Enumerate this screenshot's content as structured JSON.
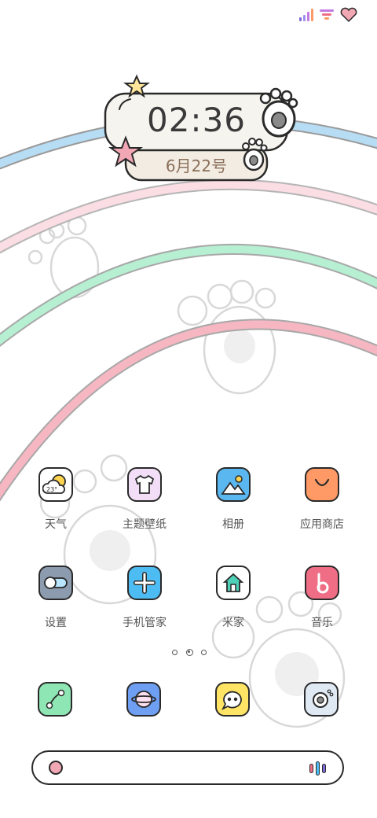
{
  "status_bar": {
    "icons": [
      "signal-icon",
      "wifi-icon",
      "battery-heart-icon"
    ],
    "colors": {
      "signal": "#7b6cd8",
      "wifi": "#c27be0",
      "heart": "#f2a7b4"
    }
  },
  "clock": {
    "time": "02:36",
    "date": "6月22号"
  },
  "apps_row1": [
    {
      "label": "天气",
      "icon": "weather-icon",
      "temp": "23°",
      "color": "#ffffff"
    },
    {
      "label": "主题壁纸",
      "icon": "theme-shirt-icon",
      "color": "#f2dff7"
    },
    {
      "label": "相册",
      "icon": "gallery-icon",
      "color": "#5ab7ef"
    },
    {
      "label": "应用商店",
      "icon": "app-store-bag-icon",
      "color": "#ff9966"
    }
  ],
  "apps_row2": [
    {
      "label": "设置",
      "icon": "settings-toggle-icon",
      "color": "#8c9cae"
    },
    {
      "label": "手机管家",
      "icon": "security-plus-icon",
      "color": "#4dbcf2"
    },
    {
      "label": "米家",
      "icon": "home-icon",
      "color": "#ffffff"
    },
    {
      "label": "音乐",
      "icon": "music-note-icon",
      "color": "#ef6e86"
    }
  ],
  "dock": [
    {
      "icon": "phone-icon",
      "color": "#8ee6b4"
    },
    {
      "icon": "browser-planet-icon",
      "color": "#6e9ff2"
    },
    {
      "icon": "messages-icon",
      "color": "#ffe466"
    },
    {
      "icon": "camera-icon",
      "color": "#dfe9f4"
    }
  ],
  "page_indicator": {
    "count": 3,
    "active": 2
  },
  "search_bar": {
    "dot_color": "#f2a7b4",
    "voice_colors": [
      "#ef6e86",
      "#4dbcf2",
      "#7b6cd8"
    ]
  },
  "palette": {
    "arc_blue": "#b7ddf5",
    "arc_pink": "#fbdde4",
    "arc_green": "#b6efd2",
    "arc_rose": "#f6b7c2",
    "outline": "#2a2a2a"
  }
}
